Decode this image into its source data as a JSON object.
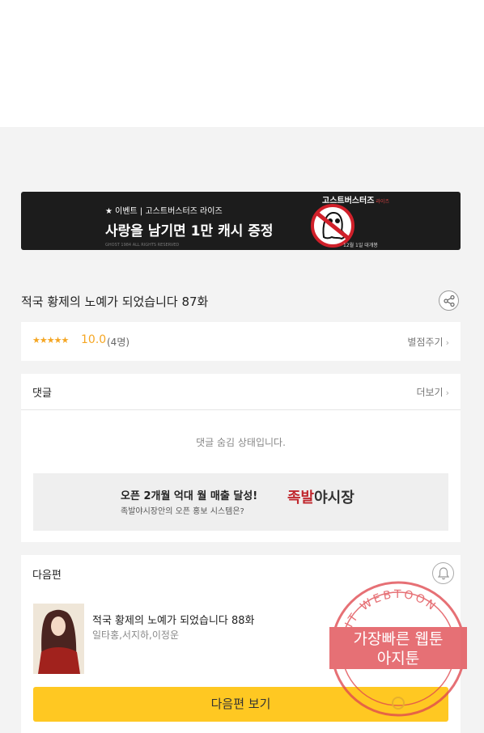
{
  "banner": {
    "subtitle": "★ 이벤트 | 고스트버스터즈 라이즈",
    "headline": "사랑을 남기면 1만 캐시 증정",
    "fine_print": "GHOST 1984 ALL RIGHTS RESERVED",
    "logo_title": "고스트버스터즈",
    "logo_sub": "라이즈",
    "release_date": "12월 1일 대개봉"
  },
  "episode": {
    "title": "적국 황제의 노예가 되었습니다 87화"
  },
  "rating": {
    "stars": "★★★★★",
    "score": "10.0",
    "count": "(4명)",
    "rate_label": "별점주기"
  },
  "comments": {
    "heading": "댓글",
    "more_label": "더보기",
    "hidden_message": "댓글 숨김 상태입니다."
  },
  "promo": {
    "line1": "오픈 2개월 억대 월 매출 달성!",
    "line2": "족발야시장안의 오픈 홍보 시스템은?",
    "logo_a": "족발",
    "logo_b": "야시장"
  },
  "next": {
    "heading": "다음편",
    "title": "적국 황제의 노예가 되었습니다 88화",
    "authors": "일타홍,서지하,이정운",
    "button_label": "다음편 보기"
  },
  "watermark": {
    "arc_text": "AGIT WEBTOON",
    "line1": "가장빠른 웹툰",
    "line2": "아지툰"
  },
  "colors": {
    "accent": "#ffc822",
    "rating": "#f5a623",
    "stamp": "#e0484f"
  }
}
